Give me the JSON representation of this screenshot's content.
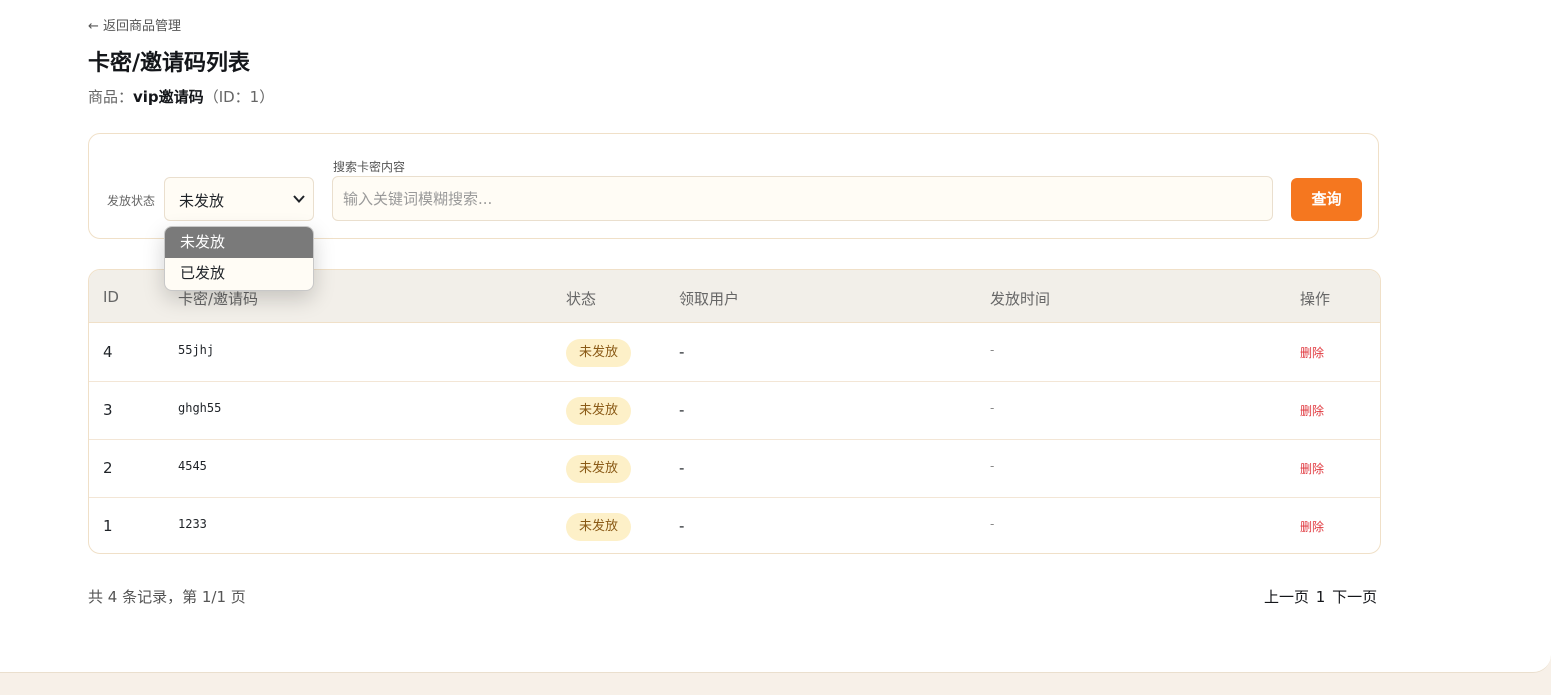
{
  "nav": {
    "back_label": "← 返回商品管理"
  },
  "header": {
    "title": "卡密/邀请码列表",
    "product_prefix": "商品：",
    "product_name": "vip邀请码",
    "product_id_text": "（ID：1）"
  },
  "filter": {
    "status_label": "发放状态",
    "status_selected": "未发放",
    "status_options": [
      "未发放",
      "已发放"
    ],
    "search_label": "搜索卡密内容",
    "search_placeholder": "输入关键词模糊搜索...",
    "search_value": "",
    "query_button": "查询"
  },
  "table": {
    "columns": [
      "ID",
      "卡密/邀请码",
      "状态",
      "领取用户",
      "发放时间",
      "操作"
    ],
    "rows": [
      {
        "id": "4",
        "code": "55jhj",
        "status": "未发放",
        "user": "-",
        "time": "-",
        "action": "删除"
      },
      {
        "id": "3",
        "code": "ghgh55",
        "status": "未发放",
        "user": "-",
        "time": "-",
        "action": "删除"
      },
      {
        "id": "2",
        "code": "4545",
        "status": "未发放",
        "user": "-",
        "time": "-",
        "action": "删除"
      },
      {
        "id": "1",
        "code": "1233",
        "status": "未发放",
        "user": "-",
        "time": "-",
        "action": "删除"
      }
    ]
  },
  "pagination": {
    "summary": "共 4 条记录，第 1/1 页",
    "prev": "上一页",
    "current": "1",
    "next": "下一页"
  },
  "colors": {
    "accent": "#f5771f",
    "danger": "#e0383e",
    "badge_bg": "#fdf0c8",
    "badge_text": "#8a5a16"
  }
}
